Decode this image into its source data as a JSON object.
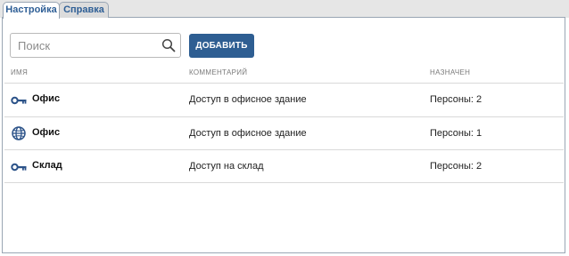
{
  "tabs": [
    {
      "label": "Настройка",
      "active": true
    },
    {
      "label": "Справка",
      "active": false
    }
  ],
  "search": {
    "placeholder": "Поиск",
    "value": "",
    "icon": "search-icon"
  },
  "toolbar": {
    "add_label": "ДОБАВИТЬ"
  },
  "table": {
    "headers": {
      "name": "ИМЯ",
      "comment": "КОММЕНТАРИЙ",
      "assigned": "НАЗНАЧЕН"
    },
    "rows": [
      {
        "icon": "key-icon",
        "name": "Офис",
        "comment": "Доступ в офисное здание",
        "assigned": "Персоны: 2"
      },
      {
        "icon": "globe-icon",
        "name": "Офис",
        "comment": "Доступ в офисное здание",
        "assigned": "Персоны: 1"
      },
      {
        "icon": "key-icon",
        "name": "Склад",
        "comment": "Доступ на склад",
        "assigned": "Персоны: 2"
      }
    ]
  },
  "colors": {
    "accent": "#2e5e92",
    "tab_text": "#2f5f96",
    "icon": "#2b5288"
  }
}
